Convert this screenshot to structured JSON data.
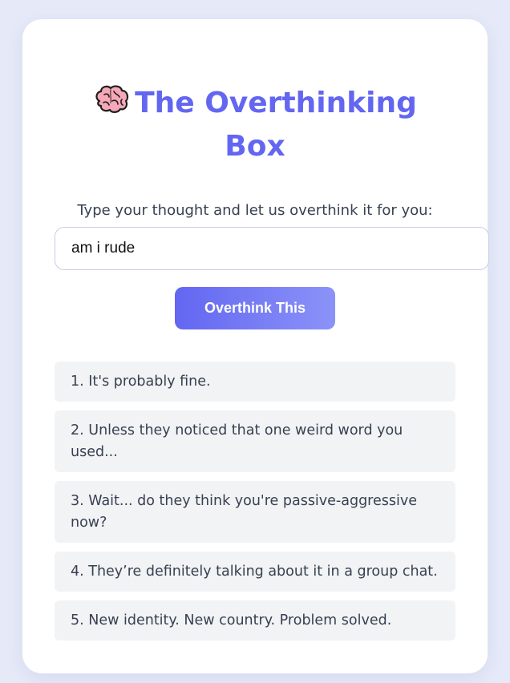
{
  "page": {
    "title_line1": "The Overthinking",
    "title_line2": "Box",
    "title_icon": "brain-icon",
    "subtitle": "Type your thought and let us overthink it for you:"
  },
  "input": {
    "value": "am i rude"
  },
  "button": {
    "label": "Overthink This"
  },
  "results": [
    "1. It's probably fine.",
    "2. Unless they noticed that one weird word you used...",
    "3. Wait... do they think you're passive-aggressive now?",
    "4. They’re definitely talking about it in a group chat.",
    "5. New identity. New country. Problem solved."
  ],
  "colors": {
    "accent": "#6366f1",
    "background": "#e6eaf8",
    "card": "#ffffff",
    "result_bg": "#f2f3f5",
    "text": "#374151"
  }
}
